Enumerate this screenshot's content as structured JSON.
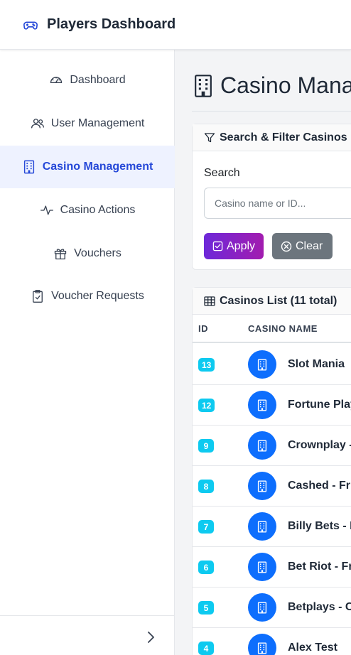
{
  "header": {
    "title": "Players Dashboard",
    "icon": "gamepad-icon",
    "accent": "#2548d8"
  },
  "sidebar": {
    "items": [
      {
        "label": "Dashboard",
        "icon": "speedometer-icon",
        "active": false
      },
      {
        "label": "User Management",
        "icon": "users-icon",
        "active": false
      },
      {
        "label": "Casino Management",
        "icon": "building-icon",
        "active": true
      },
      {
        "label": "Casino Actions",
        "icon": "activity-icon",
        "active": false
      },
      {
        "label": "Vouchers",
        "icon": "gift-icon",
        "active": false
      },
      {
        "label": "Voucher Requests",
        "icon": "clipboard-check-icon",
        "active": false
      }
    ],
    "collapse_icon": "chevron-right-icon"
  },
  "main": {
    "page_title": "Casino Management",
    "filter": {
      "title": "Search & Filter Casinos",
      "search_label": "Search",
      "search_placeholder": "Casino name or ID...",
      "search_value": "",
      "apply_label": "Apply",
      "clear_label": "Clear"
    },
    "list": {
      "title": "Casinos List (11 total)",
      "columns": [
        "ID",
        "CASINO NAME"
      ],
      "rows": [
        {
          "id": "13",
          "name": "Slot Mania"
        },
        {
          "id": "12",
          "name": "Fortune Play"
        },
        {
          "id": "9",
          "name": "Crownplay -"
        },
        {
          "id": "8",
          "name": "Cashed - Fr"
        },
        {
          "id": "7",
          "name": "Billy Bets - I"
        },
        {
          "id": "6",
          "name": "Bet Riot - Fr"
        },
        {
          "id": "5",
          "name": "Betplays - C"
        },
        {
          "id": "4",
          "name": "Alex Test"
        }
      ]
    }
  },
  "colors": {
    "badge": "#0dcaf0",
    "avatar": "#0d6efd",
    "apply_start": "#6d28d9",
    "apply_end": "#a21caf",
    "clear": "#6c757d"
  }
}
